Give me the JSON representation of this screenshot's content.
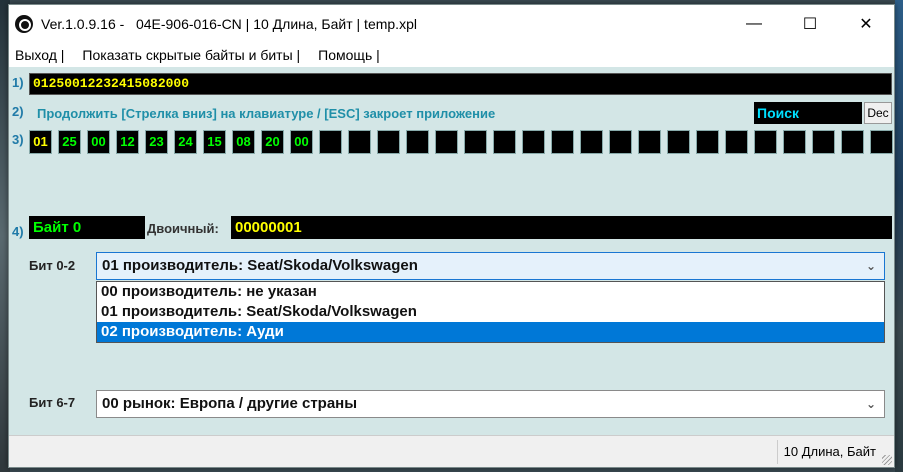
{
  "window": {
    "title": "Ver.1.0.9.16 -   04E-906-016-CN | 10 Длина, Байт | temp.xpl",
    "controls": {
      "minimize": "—",
      "maximize": "☐",
      "close": "✕"
    }
  },
  "menu": {
    "items": [
      "Выход |",
      "Показать скрытые байты и биты |",
      "Помощь |"
    ]
  },
  "row1": {
    "num": "1)",
    "hex": "01250012232415082000"
  },
  "row2": {
    "num": "2)",
    "hint": "Продолжить [Стрелка вниз] на клавиатуре / [ESC] закроет приложение",
    "search_label": "Поиск",
    "dec_label": "Dec"
  },
  "row3": {
    "num": "3)",
    "bytes": [
      "01",
      "25",
      "00",
      "12",
      "23",
      "24",
      "15",
      "08",
      "20",
      "00",
      "",
      "",
      "",
      "",
      "",
      "",
      "",
      "",
      "",
      "",
      "",
      "",
      "",
      "",
      "",
      "",
      "",
      "",
      "",
      ""
    ]
  },
  "row4": {
    "num": "4)",
    "byte_label": "Байт 0",
    "binary_label": "Двоичный:",
    "binary_value": "00000001"
  },
  "bit02": {
    "label": "Бит 0-2",
    "selected": "01 производитель: Seat/Skoda/Volkswagen",
    "options": [
      "00 производитель: не указан",
      "01 производитель: Seat/Skoda/Volkswagen",
      "02 производитель: Ауди"
    ],
    "highlighted_index": 2
  },
  "bit67": {
    "label": "Бит 6-7",
    "selected": "00 рынок: Европа / другие страны"
  },
  "status": {
    "text": "10 Длина, Байт"
  }
}
